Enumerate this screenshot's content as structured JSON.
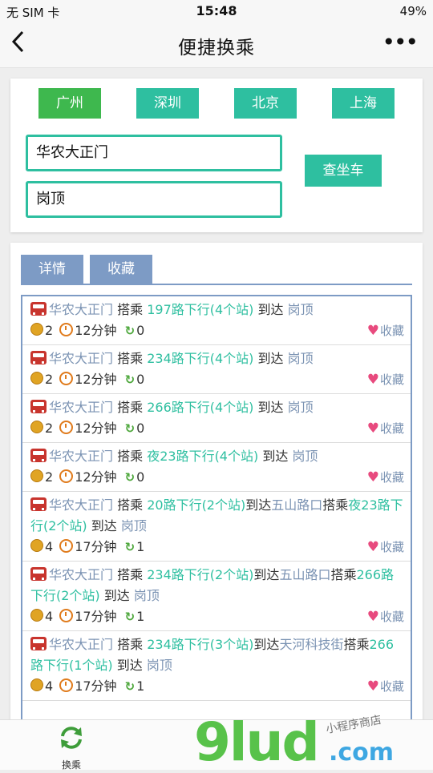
{
  "status_bar": {
    "carrier": "无 SIM 卡",
    "time": "15:48",
    "battery": "49%"
  },
  "nav": {
    "title": "便捷换乘",
    "more_label": "•••"
  },
  "cities": [
    "广州",
    "深圳",
    "北京",
    "上海"
  ],
  "search": {
    "from_value": "华农大正门",
    "to_value": "岗顶",
    "query_label": "查坐车"
  },
  "tabs": [
    "详情",
    "收藏"
  ],
  "fav_label": "收藏",
  "routes": [
    {
      "segments": [
        {
          "t": "place",
          "v": "华农大正门"
        },
        {
          "t": "text",
          "v": " 搭乘 "
        },
        {
          "t": "line",
          "v": "197路下行(4个站)"
        },
        {
          "t": "text",
          "v": " 到达 "
        },
        {
          "t": "place",
          "v": "岗顶"
        }
      ],
      "fare": "2",
      "time": "12分钟",
      "transfers": "0"
    },
    {
      "segments": [
        {
          "t": "place",
          "v": "华农大正门"
        },
        {
          "t": "text",
          "v": " 搭乘 "
        },
        {
          "t": "line",
          "v": "234路下行(4个站)"
        },
        {
          "t": "text",
          "v": " 到达 "
        },
        {
          "t": "place",
          "v": "岗顶"
        }
      ],
      "fare": "2",
      "time": "12分钟",
      "transfers": "0"
    },
    {
      "segments": [
        {
          "t": "place",
          "v": "华农大正门"
        },
        {
          "t": "text",
          "v": " 搭乘 "
        },
        {
          "t": "line",
          "v": "266路下行(4个站)"
        },
        {
          "t": "text",
          "v": " 到达 "
        },
        {
          "t": "place",
          "v": "岗顶"
        }
      ],
      "fare": "2",
      "time": "12分钟",
      "transfers": "0"
    },
    {
      "segments": [
        {
          "t": "place",
          "v": "华农大正门"
        },
        {
          "t": "text",
          "v": " 搭乘 "
        },
        {
          "t": "line",
          "v": "夜23路下行(4个站)"
        },
        {
          "t": "text",
          "v": " 到达 "
        },
        {
          "t": "place",
          "v": "岗顶"
        }
      ],
      "fare": "2",
      "time": "12分钟",
      "transfers": "0"
    },
    {
      "segments": [
        {
          "t": "place",
          "v": "华农大正门"
        },
        {
          "t": "text",
          "v": " 搭乘 "
        },
        {
          "t": "line",
          "v": "20路下行(2个站)"
        },
        {
          "t": "text",
          "v": "到达"
        },
        {
          "t": "place",
          "v": "五山路口"
        },
        {
          "t": "text",
          "v": "搭乘"
        },
        {
          "t": "line",
          "v": "夜23路下行(2个站)"
        },
        {
          "t": "text",
          "v": " 到达 "
        },
        {
          "t": "place",
          "v": "岗顶"
        }
      ],
      "fare": "4",
      "time": "17分钟",
      "transfers": "1"
    },
    {
      "segments": [
        {
          "t": "place",
          "v": "华农大正门"
        },
        {
          "t": "text",
          "v": " 搭乘 "
        },
        {
          "t": "line",
          "v": "234路下行(2个站)"
        },
        {
          "t": "text",
          "v": "到达"
        },
        {
          "t": "place",
          "v": "五山路口"
        },
        {
          "t": "text",
          "v": "搭乘"
        },
        {
          "t": "line",
          "v": "266路下行(2个站)"
        },
        {
          "t": "text",
          "v": " 到达 "
        },
        {
          "t": "place",
          "v": "岗顶"
        }
      ],
      "fare": "4",
      "time": "17分钟",
      "transfers": "1"
    },
    {
      "segments": [
        {
          "t": "place",
          "v": "华农大正门"
        },
        {
          "t": "text",
          "v": " 搭乘 "
        },
        {
          "t": "line",
          "v": "234路下行(3个站)"
        },
        {
          "t": "text",
          "v": "到达"
        },
        {
          "t": "place",
          "v": "天河科技街"
        },
        {
          "t": "text",
          "v": "搭乘"
        },
        {
          "t": "line",
          "v": "266路下行(1个站)"
        },
        {
          "t": "text",
          "v": " 到达 "
        },
        {
          "t": "place",
          "v": "岗顶"
        }
      ],
      "fare": "4",
      "time": "17分钟",
      "transfers": "1"
    }
  ],
  "bottom_tab": {
    "label": "换乘"
  },
  "watermark": {
    "main": "9lud",
    "suffix": ".com",
    "sub": "小程序商店"
  },
  "colors": {
    "accent": "#2ebfa0",
    "active_city": "#3eb84e",
    "tab": "#7d9bc5",
    "place": "#7b93b3",
    "heart": "#e84a7e"
  }
}
